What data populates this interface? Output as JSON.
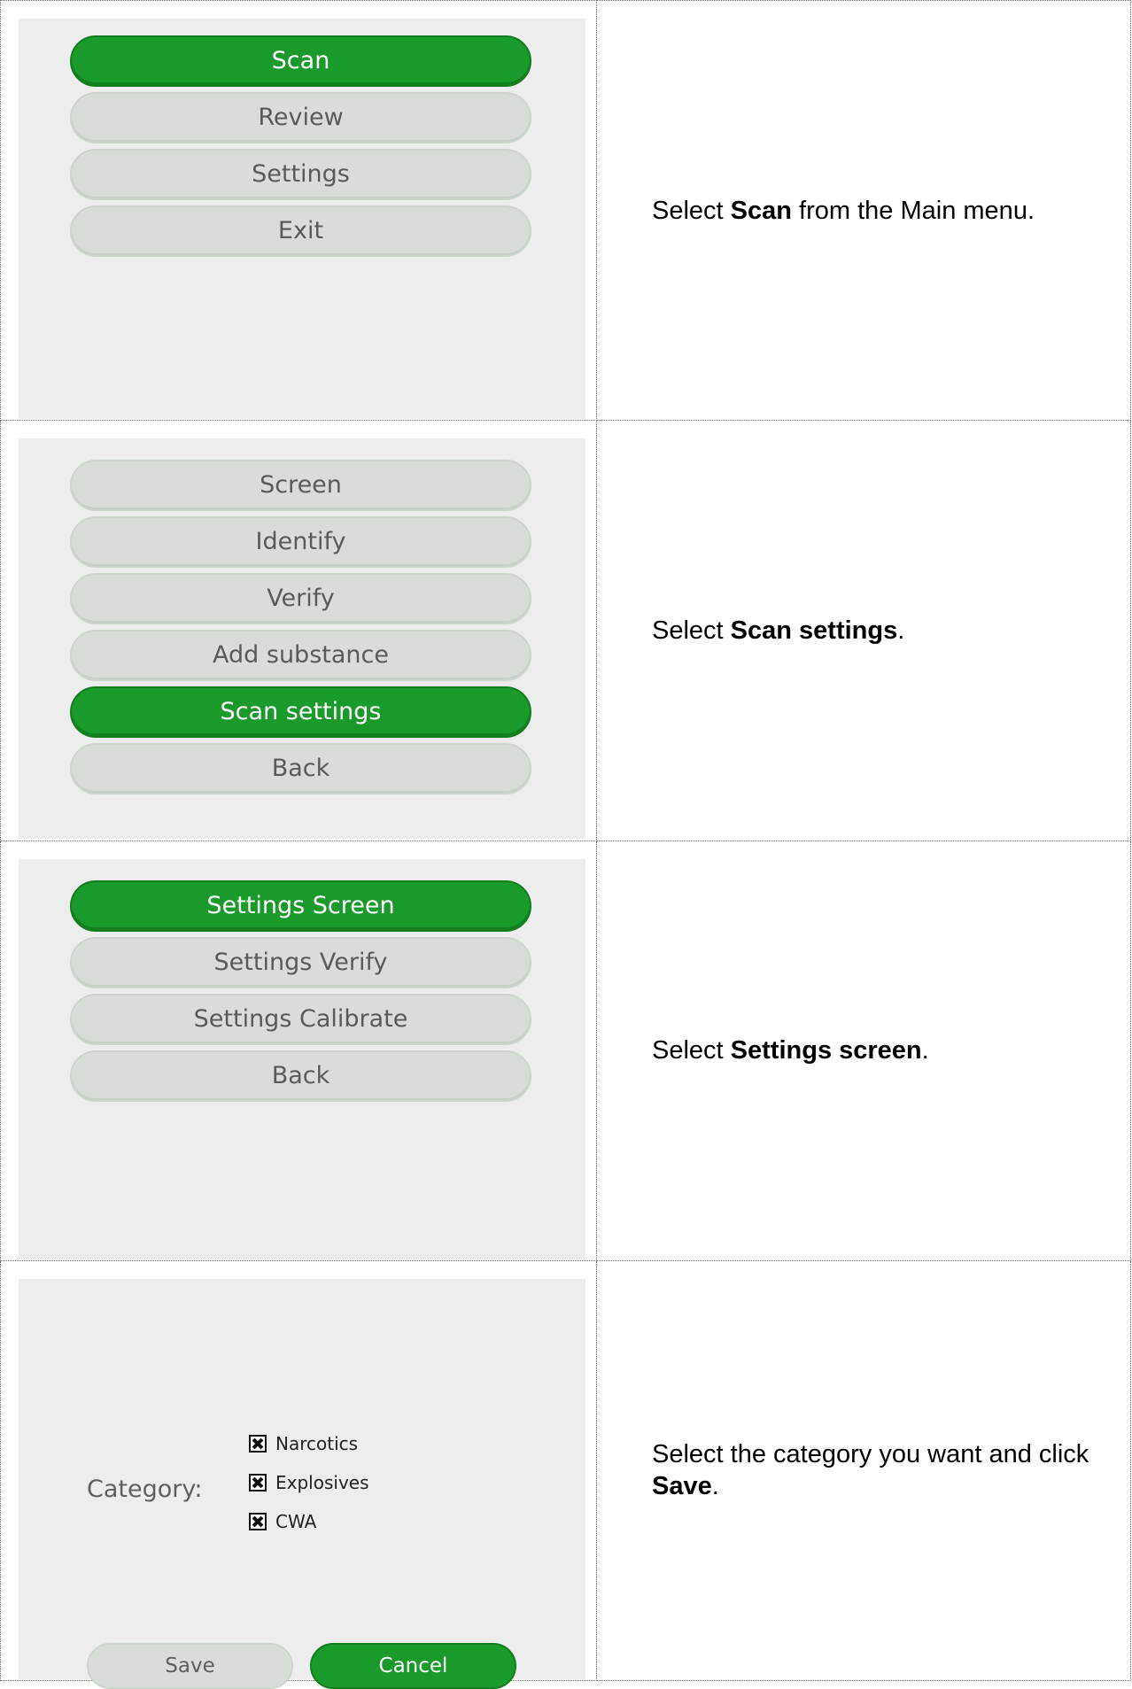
{
  "steps": [
    {
      "menu": [
        "Scan",
        "Review",
        "Settings",
        "Exit"
      ],
      "active": 0,
      "instruction": {
        "pre": "Select ",
        "bold": "Scan",
        "post": " from the Main menu."
      }
    },
    {
      "menu": [
        "Screen",
        "Identify",
        "Verify",
        "Add substance",
        "Scan settings",
        "Back"
      ],
      "active": 4,
      "instruction": {
        "pre": "Select ",
        "bold": "Scan settings",
        "post": "."
      }
    },
    {
      "menu": [
        "Settings Screen",
        "Settings Verify",
        "Settings Calibrate",
        "Back"
      ],
      "active": 0,
      "instruction": {
        "pre": "Select ",
        "bold": "Settings screen",
        "post": "."
      }
    },
    {
      "category_label": "Category:",
      "categories": [
        {
          "label": "Narcotics",
          "checked": true
        },
        {
          "label": "Explosives",
          "checked": true
        },
        {
          "label": "CWA",
          "checked": true
        }
      ],
      "save_label": "Save",
      "cancel_label": "Cancel",
      "instruction": {
        "pre": "Select the category you want and click ",
        "bold": "Save",
        "post": "."
      }
    }
  ],
  "colors": {
    "active": "#1a9a2a",
    "inactive": "#d8ddd8",
    "panel": "#ededed"
  }
}
